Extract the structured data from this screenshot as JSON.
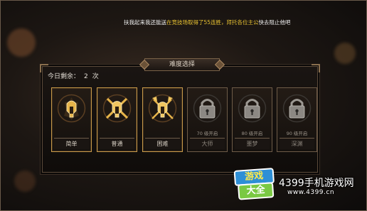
{
  "broadcast": {
    "white_1": "扶我起来我还能送",
    "yellow_1": "在竞技场取得了55连胜，拜托各位主公",
    "white_2": "快去阻止他吧"
  },
  "dialog": {
    "title": "难度选择",
    "remaining_label": "今日剩余：",
    "remaining_count": "2",
    "remaining_unit": "次",
    "difficulties": [
      {
        "label": "简单",
        "locked": false,
        "unlock_text": "",
        "emblem": "spartan-helmet-icon"
      },
      {
        "label": "普通",
        "locked": false,
        "unlock_text": "",
        "emblem": "helmet-crossed-swords-icon"
      },
      {
        "label": "困难",
        "locked": false,
        "unlock_text": "",
        "emblem": "helmet-crossed-axes-icon"
      },
      {
        "label": "大师",
        "locked": true,
        "unlock_text": "70 级开启",
        "emblem": "padlock-icon"
      },
      {
        "label": "噩梦",
        "locked": true,
        "unlock_text": "80 级开启",
        "emblem": "padlock-icon"
      },
      {
        "label": "深渊",
        "locked": true,
        "unlock_text": "90 级开启",
        "emblem": "padlock-icon"
      }
    ]
  },
  "watermark": {
    "logo_top": "游戏",
    "logo_bottom": "大全",
    "site_name": "4399手机游戏网",
    "site_url": "www.4399.cn"
  },
  "colors": {
    "broadcast_highlight": "#e8c232",
    "frame_gold": "#c89a4a",
    "emblem_gold": "#e6b44a"
  }
}
